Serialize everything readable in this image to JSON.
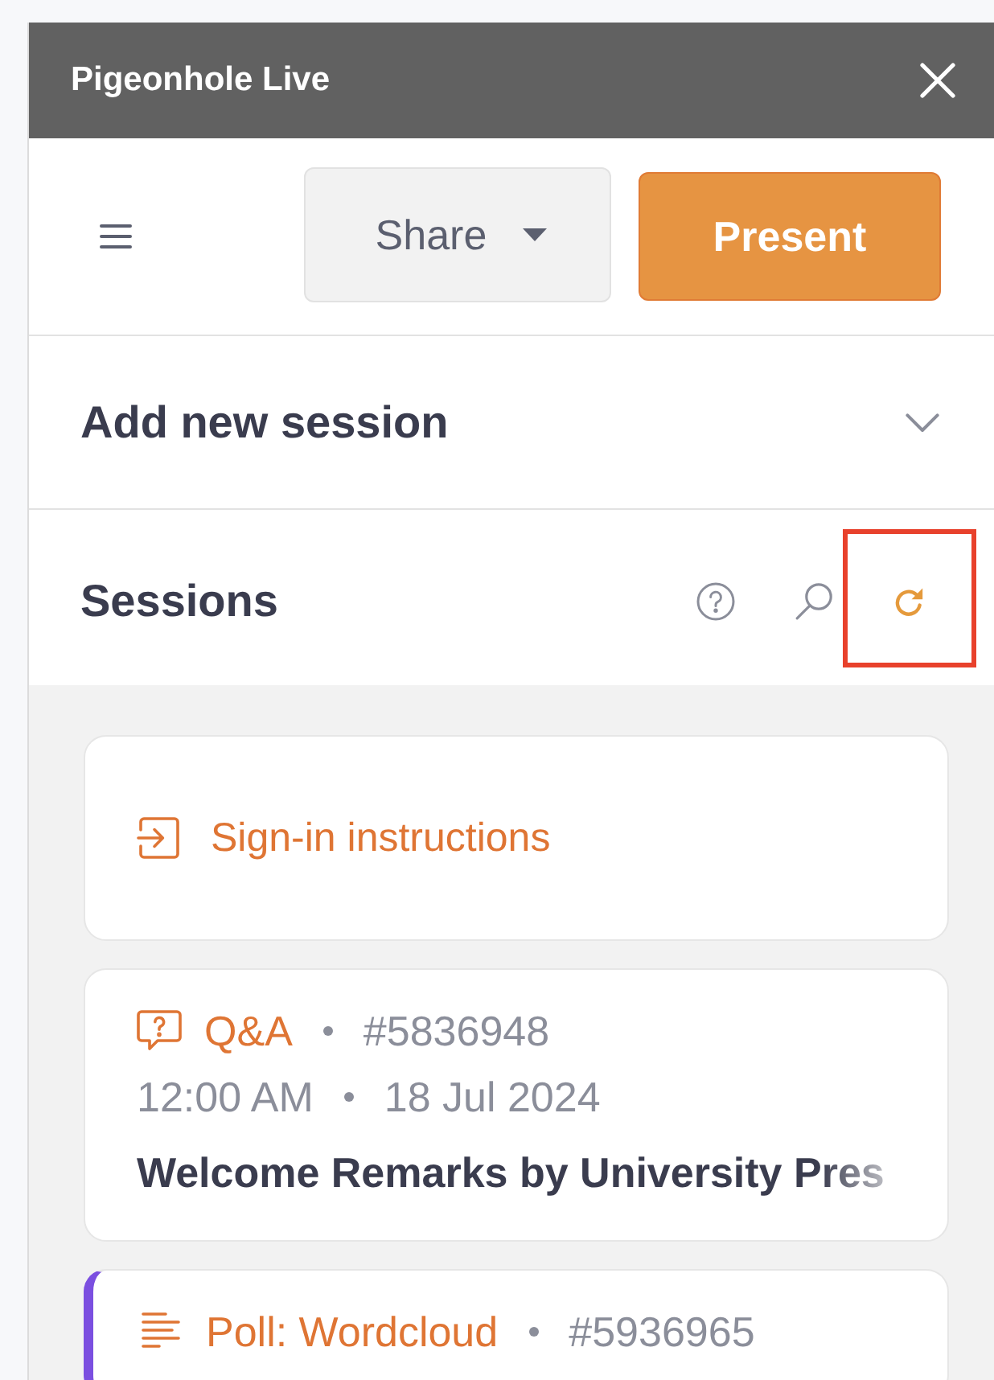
{
  "window": {
    "title": "Pigeonhole Live"
  },
  "toolbar": {
    "share": {
      "label": "Share"
    },
    "present": {
      "label": "Present"
    }
  },
  "add_session": {
    "label": "Add new session",
    "expanded": false
  },
  "sessions": {
    "title": "Sessions",
    "actions": [
      {
        "kind": "help",
        "highlighted": false
      },
      {
        "kind": "search",
        "highlighted": false
      },
      {
        "kind": "refresh",
        "highlighted": true
      }
    ],
    "items": [
      {
        "kind": "link",
        "label": "Sign-in instructions"
      },
      {
        "kind": "qa",
        "type_label": "Q&A",
        "number": "#5836948",
        "time": "12:00 AM",
        "date": "18 Jul 2024",
        "title": "Welcome Remarks by University Pres",
        "active": false
      },
      {
        "kind": "poll",
        "type_label": "Poll: Wordcloud",
        "number": "#5936965",
        "active": true
      }
    ]
  }
}
